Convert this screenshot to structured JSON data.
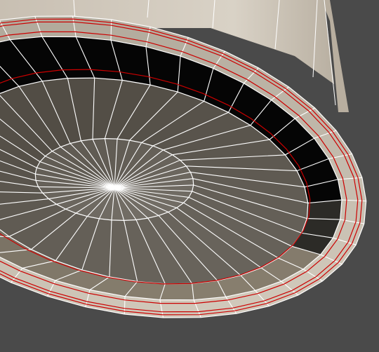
{
  "viewport": {
    "view": "perspective",
    "shading": "smooth-shaded-with-wireframe",
    "background_color": "#4a4a4a",
    "wire_color": "#ffffff",
    "selected_edge_color": "#cc0000"
  },
  "model": {
    "object": "cylinder",
    "selection_mode": "edge-loops",
    "radial_segments": 40,
    "cap_rings": 2
  }
}
